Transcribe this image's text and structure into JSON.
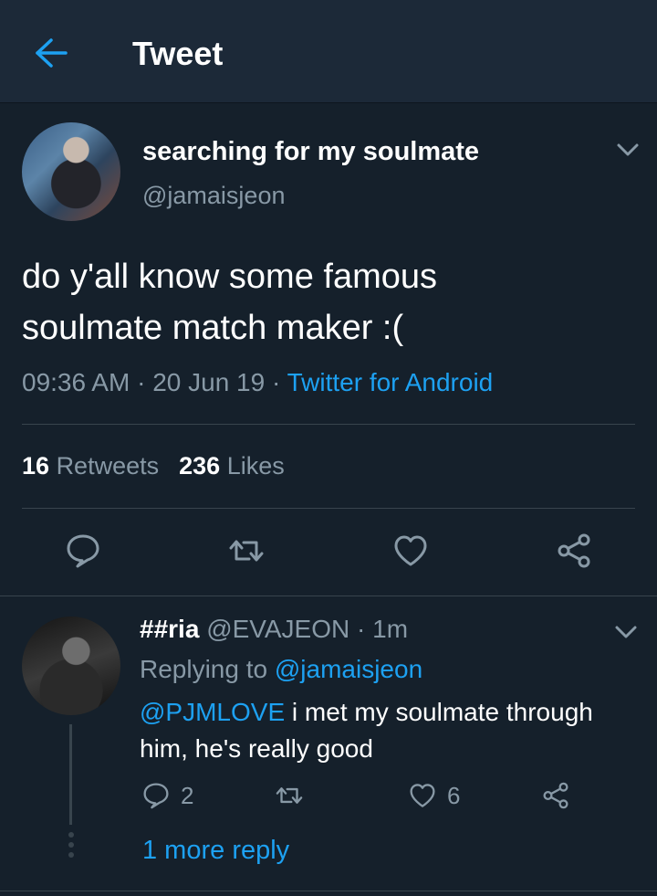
{
  "header": {
    "title": "Tweet",
    "back_icon": "arrow-left-icon"
  },
  "tweet": {
    "author_name": "searching for my soulmate",
    "author_handle": "@jamaisjeon",
    "text_line1": "do y'all know some famous",
    "text_line2": "soulmate match maker :(",
    "time": "09:36 AM",
    "date": "20 Jun 19",
    "source": "Twitter for Android",
    "sep": " · ",
    "retweets_count": "16",
    "retweets_label": "Retweets",
    "likes_count": "236",
    "likes_label": "Likes",
    "actions": [
      "reply-icon",
      "retweet-icon",
      "heart-icon",
      "share-icon"
    ]
  },
  "reply": {
    "name": "##ria",
    "handle": "@EVAJEON",
    "time": "1m",
    "replying_prefix": "Replying to",
    "replying_to": "@jamaisjeon",
    "mention": "@PJMLOVE",
    "text": " i met my soulmate through him, he's really good",
    "reply_count": "2",
    "like_count": "6",
    "more_replies": "1 more reply"
  },
  "colors": {
    "background": "#15202b",
    "header": "#1c2938",
    "accent": "#1da1f2",
    "muted": "#8899a6",
    "divider": "#38444d"
  }
}
